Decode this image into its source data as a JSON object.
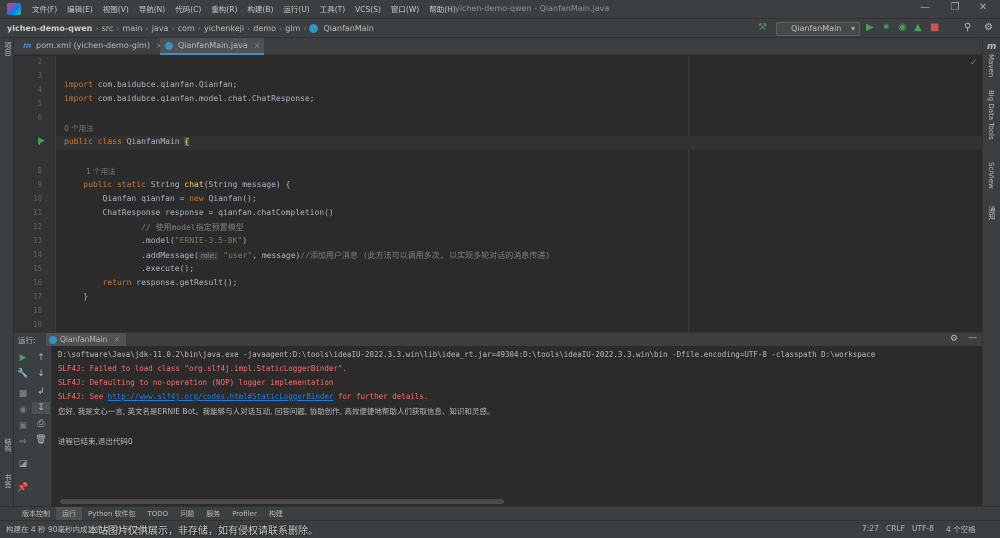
{
  "window": {
    "title": "yichen-demo-qwen - QianfanMain.java",
    "menu": [
      "文件(F)",
      "编辑(E)",
      "视图(V)",
      "导航(N)",
      "代码(C)",
      "重构(R)",
      "构建(B)",
      "运行(U)",
      "工具(T)",
      "VCS(S)",
      "窗口(W)",
      "帮助(H)"
    ]
  },
  "breadcrumb": [
    "yichen-demo-qwen",
    "src",
    "main",
    "java",
    "com",
    "yichenkeji",
    "demo",
    "glm",
    "QianfanMain"
  ],
  "toolbar": {
    "run_config": "QianfanMain"
  },
  "tabs": [
    {
      "label": "pom.xml (yichen-demo-glm)",
      "icon": "maven-m-icon"
    },
    {
      "label": "QianfanMain.java",
      "icon": "class-c-icon"
    }
  ],
  "left_tool_labels": [
    "项目",
    "结构",
    "书签"
  ],
  "right_tool_labels": [
    "Maven",
    "Big Data Tools",
    "SciView",
    "通知"
  ],
  "editor": {
    "line_numbers": [
      "2",
      "3",
      "4",
      "5",
      "6",
      "7",
      "8",
      "9",
      "10",
      "11",
      "12",
      "13",
      "14",
      "15",
      "16",
      "17",
      "18",
      "19"
    ],
    "current_line": "7",
    "lines": {
      "l4_a": "import",
      "l4_b": " com.baidubce.qianfan.Qianfan;",
      "l5_a": "import",
      "l5_b": " com.baidubce.qianfan.model.chat.ChatResponse;",
      "hint_class": "0 个用法",
      "l7_a": "public class",
      "l7_b": " QianfanMain ",
      "l7_c": "{",
      "hint_method": "1 个用法",
      "l9_a": "    public static",
      "l9_b": " String ",
      "l9_c": "chat",
      "l9_d": "(String message) {",
      "l10_a": "        Qianfan qianfan = ",
      "l10_b": "new",
      "l10_c": " Qianfan();",
      "l11": "        ChatResponse response = qianfan.chatCompletion()",
      "l12": "                // 使用model指定预置模型",
      "l13_a": "                .model(",
      "l13_b": "\"ERNIE-3.5-8K\"",
      "l13_c": ")",
      "l14_a": "                .addMessage(",
      "l14_inlay": "role:",
      "l14_b": " \"user\"",
      "l14_c": ", message)",
      "l14_d": "//添加用户消息 (此方法可以调用多次, 以实现多轮对话的消息传递)",
      "l15": "                .execute();",
      "l16_a": "        return",
      "l16_b": " response.getResult();",
      "l17": "    }"
    }
  },
  "run_panel": {
    "label": "运行:",
    "tab": "QianfanMain",
    "console": {
      "cmd": "D:\\software\\Java\\jdk-11.0.2\\bin\\java.exe -javaagent:D:\\tools\\ideaIU-2022.3.3.win\\lib\\idea_rt.jar=49304:D:\\tools\\ideaIU-2022.3.3.win\\bin -Dfile.encoding=UTF-8 -classpath D:\\workspace",
      "err1": "SLF4J: Failed to load class \"org.slf4j.impl.StaticLoggerBinder\".",
      "err2": "SLF4J: Defaulting to no-operation (NOP) logger implementation",
      "err3_a": "SLF4J: See ",
      "err3_link": "http://www.slf4j.org/codes.html#StaticLoggerBinder",
      "err3_b": " for further details.",
      "output": "您好, 我是文心一言, 英文名是ERNIE Bot。我能够与人对话互动, 回答问题, 协助创作, 高效便捷地帮助人们获取信息、知识和灵感。",
      "exit": "进程已结束,退出代码0"
    }
  },
  "bottom_tools": [
    "版本控制",
    "运行",
    "Python 软件包",
    "TODO",
    "问题",
    "服务",
    "Profiler",
    "构建"
  ],
  "status": {
    "left": "构建在 4 秒 90毫秒内成功完成 (片刻 之前)",
    "position": "7:27",
    "line_sep": "CRLF",
    "encoding": "UTF-8",
    "indent": "4 个空格"
  },
  "watermark": "本站图片仅供展示，非存储，如有侵权请联系删除。",
  "colors": {
    "keyword": "#cc7832",
    "string": "#6a8759",
    "function": "#ffc66d",
    "error": "#ff6b68",
    "link": "#287bde",
    "accent": "#4a88c7"
  }
}
